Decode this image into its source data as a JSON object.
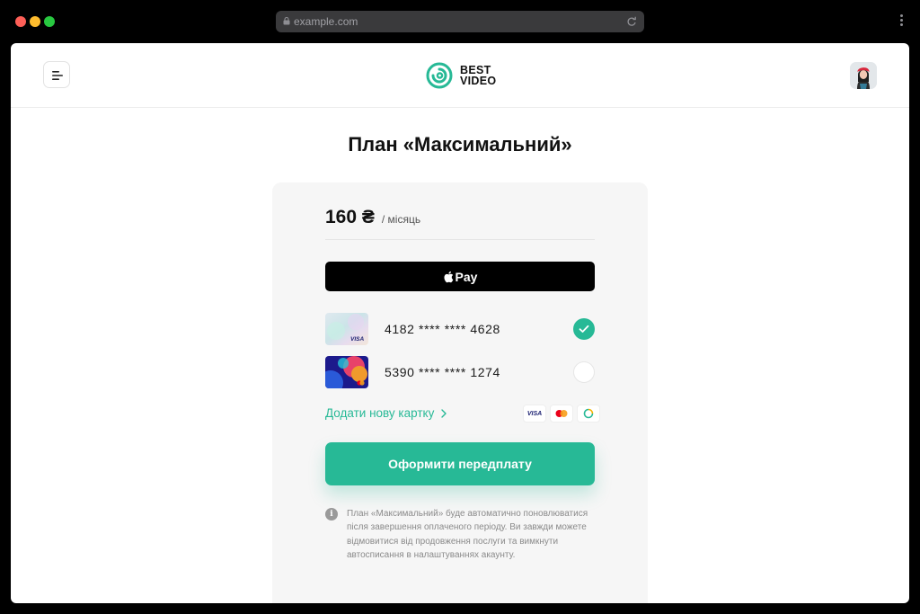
{
  "browser": {
    "url": "example.com"
  },
  "header": {
    "logo_line1": "BEST",
    "logo_line2": "VIDEO"
  },
  "page": {
    "title": "План «Максимальний»"
  },
  "plan": {
    "price": "160 ₴",
    "period": "/ місяць"
  },
  "payment": {
    "applepay_label": "Pay",
    "cards": [
      {
        "number": "4182 **** **** 4628",
        "brand": "VISA",
        "selected": true
      },
      {
        "number": "5390 **** **** 1274",
        "brand": "Mastercard",
        "selected": false
      }
    ],
    "add_card_label": "Додати нову картку",
    "brand_visa": "VISA",
    "subscribe_label": "Оформити передплату"
  },
  "info": {
    "text": "План «Максимальний» буде автоматично поновлюватися після завершення оплаченого періоду. Ви завжди можете відмовитися від продовження послуги та вимкнути автосписання в налаштуваннях акаунту."
  },
  "colors": {
    "accent": "#27b996",
    "text": "#111111",
    "card_bg": "#f6f6f6"
  }
}
